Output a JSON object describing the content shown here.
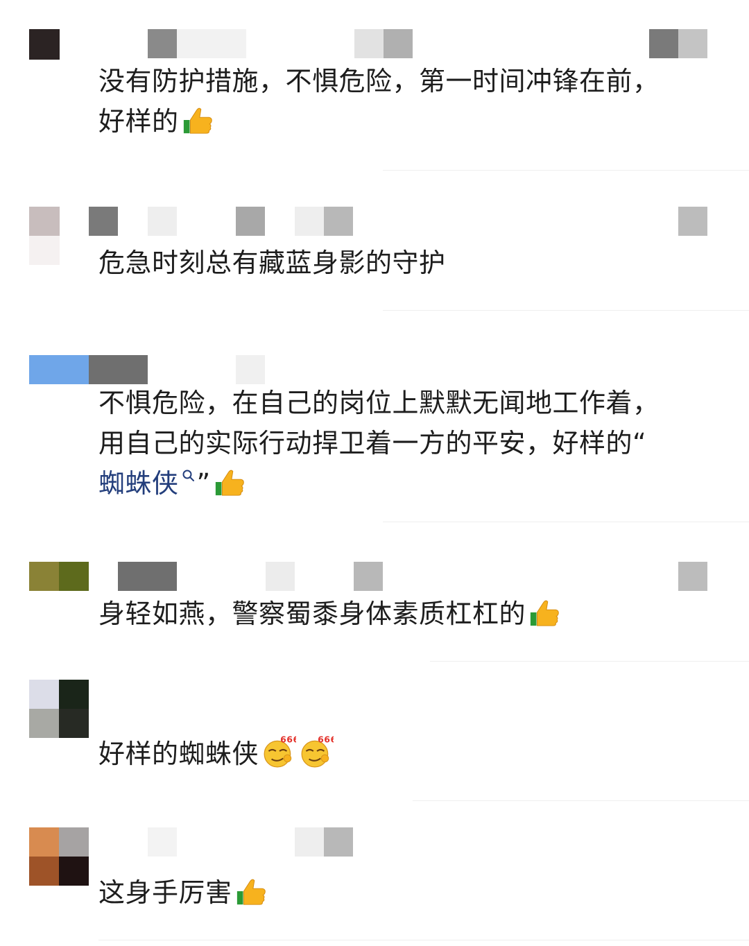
{
  "comments": [
    {
      "text_segments": [
        "没有防护措施，不惧危险，第一时间冲锋在前，",
        "好样的"
      ],
      "emojis": [
        "thumbs-up-icon"
      ]
    },
    {
      "text": "危急时刻总有藏蓝身影的守护"
    },
    {
      "text_before": "不惧危险，在自己的岗位上默默无闻地工作着，",
      "text_line2": "用自己的实际行动捍卫着一方的平安，好样的“",
      "link": "蜘蛛侠",
      "text_after": "”",
      "emojis": [
        "search-icon",
        "thumbs-up-icon"
      ]
    },
    {
      "text": "身轻如燕，警察蜀黍身体素质杠杠的",
      "emojis": [
        "thumbs-up-icon"
      ]
    },
    {
      "text": "好样的蜘蛛侠",
      "emojis": [
        "666-emoji-icon",
        "666-emoji-icon"
      ],
      "emoji_label": "666"
    },
    {
      "text": "这身手厉害",
      "emojis": [
        "thumbs-up-icon"
      ]
    }
  ],
  "colors": {
    "text": "#1d1d1d",
    "link": "#233e7c",
    "divider": "#efefef",
    "thumb_yellow": "#f7b21e",
    "cuff_green": "#2b9a36",
    "emoji_red": "#e3322b"
  }
}
